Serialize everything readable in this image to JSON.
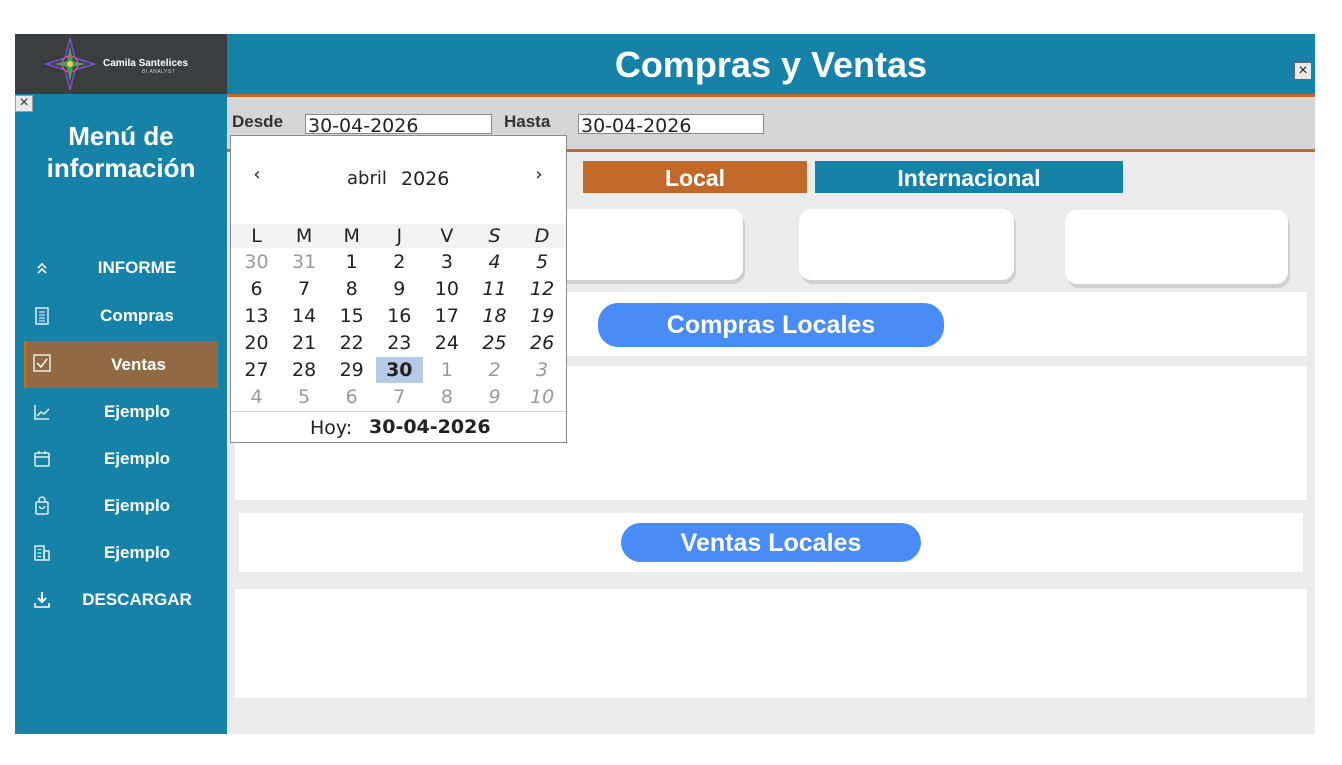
{
  "brand": {
    "name": "Camila Santelices",
    "subtitle": "BI ANALYST"
  },
  "sidebar": {
    "close_icon": "close-icon",
    "title_line1": "Menú de",
    "title_line2": "información",
    "items": [
      {
        "label": "INFORME",
        "icon": "chevrons-up-icon"
      },
      {
        "label": "Compras",
        "icon": "document-icon"
      },
      {
        "label": "Ventas",
        "icon": "checkbox-icon",
        "active": true
      },
      {
        "label": "Ejemplo",
        "icon": "line-chart-icon"
      },
      {
        "label": "Ejemplo",
        "icon": "calendar-icon"
      },
      {
        "label": "Ejemplo",
        "icon": "shopping-bag-icon"
      },
      {
        "label": "Ejemplo",
        "icon": "building-icon"
      },
      {
        "label": "DESCARGAR",
        "icon": "download-icon"
      }
    ]
  },
  "header": {
    "title": "Compras y Ventas",
    "close_icon": "close-icon"
  },
  "filters": {
    "from_label": "Desde",
    "from_value": "30-04-2026",
    "to_label": "Hasta",
    "to_value": "30-04-2026"
  },
  "tabs": [
    {
      "label": "Local",
      "color": "#c0692b",
      "active": true
    },
    {
      "label": "Internacional",
      "color": "#1682a8",
      "active": false
    }
  ],
  "sections": {
    "purchases_title": "Compras Locales",
    "sales_title": "Ventas Locales"
  },
  "calendar": {
    "month": "abril",
    "year": "2026",
    "prev": "‹",
    "next": "›",
    "weekdays": [
      "L",
      "M",
      "M",
      "J",
      "V",
      "S",
      "D"
    ],
    "weeks": [
      [
        "30",
        "31",
        "1",
        "2",
        "3",
        "4",
        "5"
      ],
      [
        "6",
        "7",
        "8",
        "9",
        "10",
        "11",
        "12"
      ],
      [
        "13",
        "14",
        "15",
        "16",
        "17",
        "18",
        "19"
      ],
      [
        "20",
        "21",
        "22",
        "23",
        "24",
        "25",
        "26"
      ],
      [
        "27",
        "28",
        "29",
        "30",
        "1",
        "2",
        "3"
      ],
      [
        "4",
        "5",
        "6",
        "7",
        "8",
        "9",
        "10"
      ]
    ],
    "selected_day": "30",
    "today_label": "Hoy:",
    "today_value": "30-04-2026"
  },
  "colors": {
    "primary": "#1682a8",
    "accent": "#c0692b",
    "active_item": "#8f6a43",
    "pill": "#4a8cf5",
    "background": "#ebebeb"
  }
}
